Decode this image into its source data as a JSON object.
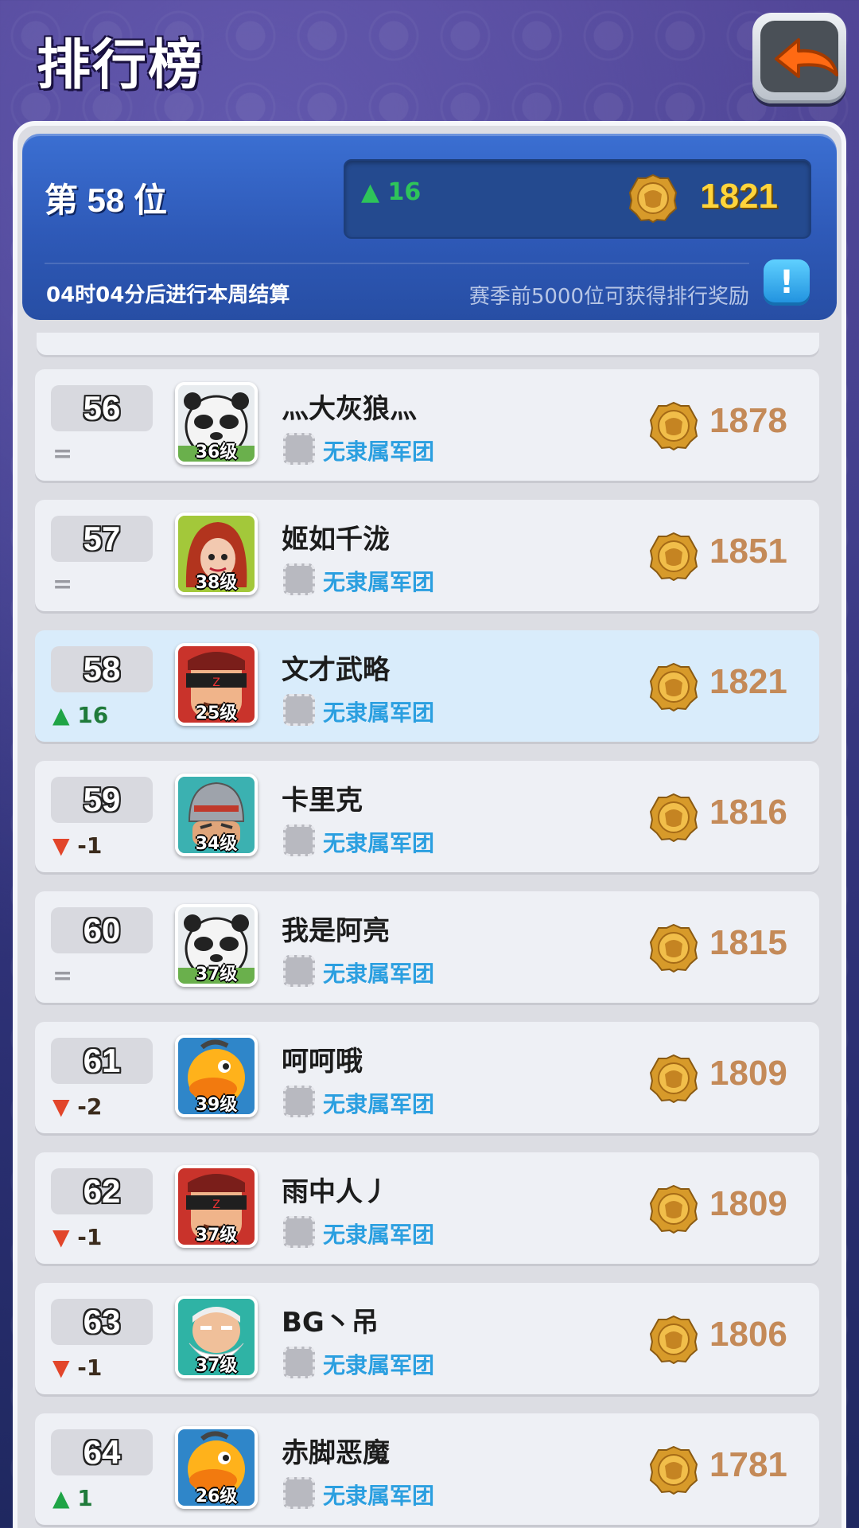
{
  "header": {
    "title": "排行榜",
    "my_rank": "第 58 位",
    "my_change": "16",
    "my_points": "1821",
    "countdown": "04时04分后进行本周结算",
    "reward_note": "赛季前5000位可获得排行奖励",
    "info_label": "!"
  },
  "colors": {
    "panel_blue": "#2e59b7",
    "self_row": "#d9ecfb",
    "guild_text": "#2b9fe0",
    "points_text": "#c48a58",
    "up_arrow": "#1fa446",
    "down_arrow": "#e2452a"
  },
  "rows": [
    {
      "rank": "56",
      "trend": "=",
      "trend_type": "same",
      "avatar": "panda",
      "level": "36级",
      "name": "灬大灰狼灬",
      "guild": "无隶属军团",
      "points": "1878"
    },
    {
      "rank": "57",
      "trend": "=",
      "trend_type": "same",
      "avatar": "red-hair",
      "level": "38级",
      "name": "姬如千泷",
      "guild": "无隶属军团",
      "points": "1851"
    },
    {
      "rank": "58",
      "trend": "16",
      "trend_type": "up",
      "avatar": "masked",
      "level": "25级",
      "name": "文才武略",
      "guild": "无隶属军团",
      "points": "1821",
      "self": true
    },
    {
      "rank": "59",
      "trend": "-1",
      "trend_type": "down",
      "avatar": "knight",
      "level": "34级",
      "name": "卡里克",
      "guild": "无隶属军团",
      "points": "1816"
    },
    {
      "rank": "60",
      "trend": "=",
      "trend_type": "same",
      "avatar": "panda",
      "level": "37级",
      "name": "我是阿亮",
      "guild": "无隶属军团",
      "points": "1815"
    },
    {
      "rank": "61",
      "trend": "-2",
      "trend_type": "down",
      "avatar": "duck",
      "level": "39级",
      "name": "呵呵哦",
      "guild": "无隶属军团",
      "points": "1809"
    },
    {
      "rank": "62",
      "trend": "-1",
      "trend_type": "down",
      "avatar": "masked",
      "level": "37级",
      "name": "雨中人丿",
      "guild": "无隶属军团",
      "points": "1809"
    },
    {
      "rank": "63",
      "trend": "-1",
      "trend_type": "down",
      "avatar": "old-man",
      "level": "37级",
      "name": "BG丶吊",
      "guild": "无隶属军团",
      "points": "1806"
    },
    {
      "rank": "64",
      "trend": "1",
      "trend_type": "up",
      "avatar": "duck",
      "level": "26级",
      "name": "赤脚恶魔",
      "guild": "无隶属军团",
      "points": "1781"
    }
  ]
}
